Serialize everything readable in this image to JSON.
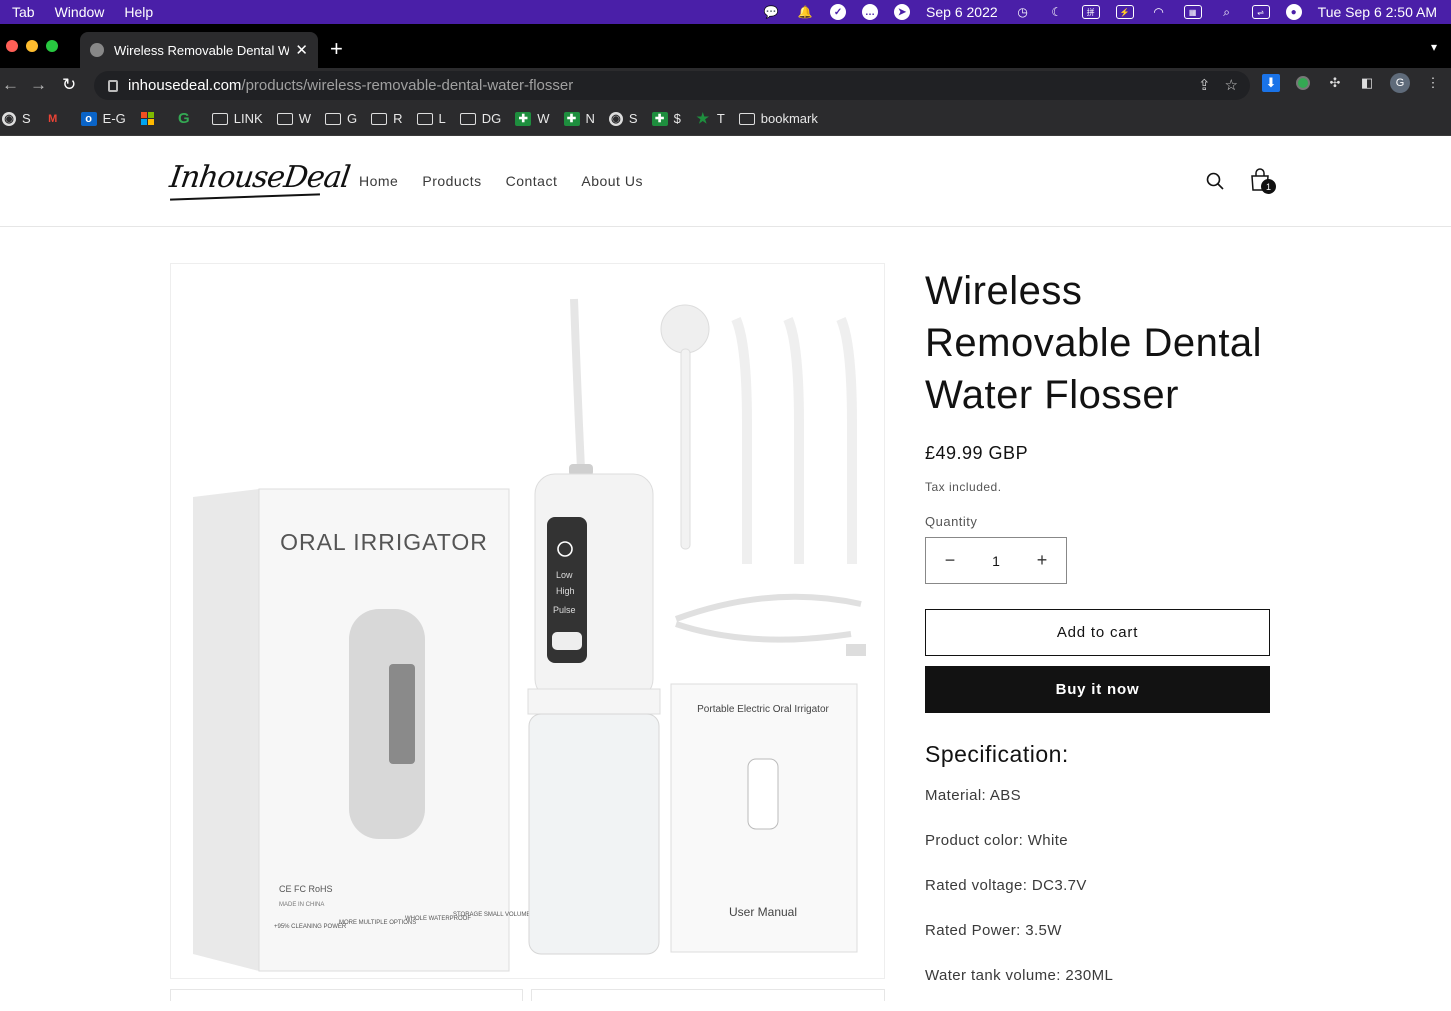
{
  "menubar": {
    "items": [
      "Tab",
      "Window",
      "Help"
    ],
    "date": "Sep 6 2022",
    "clock": "Tue Sep 6  2:50 AM"
  },
  "browser": {
    "tab_title": "Wireless Removable Dental Water Flosser",
    "url_host": "inhousedeal.com",
    "url_path": "/products/wireless-removable-dental-water-flosser",
    "profile_initial": "G"
  },
  "bookmarks": [
    {
      "icon": "globe-icon",
      "label": "S"
    },
    {
      "icon": "gmail-icon",
      "label": ""
    },
    {
      "icon": "outlook-icon",
      "label": "E-G"
    },
    {
      "icon": "microsoft-icon",
      "label": ""
    },
    {
      "icon": "g-logo-icon",
      "label": ""
    },
    {
      "icon": "folder-icon",
      "label": "LINK"
    },
    {
      "icon": "folder-icon",
      "label": "W"
    },
    {
      "icon": "folder-icon",
      "label": "G"
    },
    {
      "icon": "folder-icon",
      "label": "R"
    },
    {
      "icon": "folder-icon",
      "label": "L"
    },
    {
      "icon": "folder-icon",
      "label": "DG"
    },
    {
      "icon": "plus-icon",
      "label": "W"
    },
    {
      "icon": "plus-icon",
      "label": "N"
    },
    {
      "icon": "globe-icon",
      "label": "S"
    },
    {
      "icon": "plus-icon",
      "label": "$"
    },
    {
      "icon": "star-icon",
      "label": "T"
    },
    {
      "icon": "folder-icon",
      "label": "bookmark"
    }
  ],
  "store": {
    "logo": "InhouseDeal",
    "nav": [
      "Home",
      "Products",
      "Contact",
      "About Us"
    ],
    "cart_count": "1"
  },
  "product": {
    "title": "Wireless Removable Dental Water Flosser",
    "price": "£49.99 GBP",
    "tax_note": "Tax included.",
    "quantity_label": "Quantity",
    "quantity": "1",
    "add_to_cart": "Add to cart",
    "buy_now": "Buy it now",
    "spec_title": "Specification:",
    "specs": [
      "Material: ABS",
      "Product color: White",
      "Rated voltage: DC3.7V",
      "Rated Power: 3.5W",
      "Water tank volume: 230ML"
    ]
  },
  "image_text": {
    "box_title": "ORAL IRRIGATOR",
    "modes": [
      "Low",
      "High",
      "Pulse"
    ],
    "manual_title": "Portable Electric Oral Irrigator",
    "manual_footer": "User Manual",
    "box_features": [
      "+95% CLEANING POWER",
      "MORE MULTIPLE OPTIONS",
      "WHOLE WATERPROOF",
      "STORAGE SMALL VOLUME"
    ],
    "box_marks": "CE FC RoHS",
    "made_in": "MADE IN CHINA"
  }
}
